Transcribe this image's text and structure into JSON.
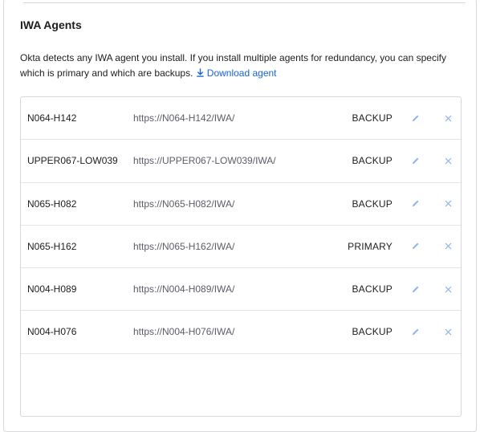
{
  "section": {
    "title": "IWA Agents",
    "description": "Okta detects any IWA agent you install. If you install multiple agents for redundancy, you can specify which is primary and which are backups.",
    "download_label": "Download agent"
  },
  "agents": [
    {
      "name": "N064-H142",
      "url": "https://N064-H142/IWA/",
      "role": "BACKUP"
    },
    {
      "name": "UPPER067-LOW039",
      "url": "https://UPPER067-LOW039/IWA/",
      "role": "BACKUP"
    },
    {
      "name": "N065-H082",
      "url": "https://N065-H082/IWA/",
      "role": "BACKUP"
    },
    {
      "name": "N065-H162",
      "url": "https://N065-H162/IWA/",
      "role": "PRIMARY"
    },
    {
      "name": "N004-H089",
      "url": "https://N004-H089/IWA/",
      "role": "BACKUP"
    },
    {
      "name": "N004-H076",
      "url": "https://N004-H076/IWA/",
      "role": "BACKUP"
    }
  ],
  "icons": {
    "edit": "pencil-icon",
    "delete": "close-icon",
    "download": "download-icon"
  },
  "colors": {
    "link": "#1662dd",
    "icon": "#8fb5ec",
    "border": "#d7d7dc"
  }
}
